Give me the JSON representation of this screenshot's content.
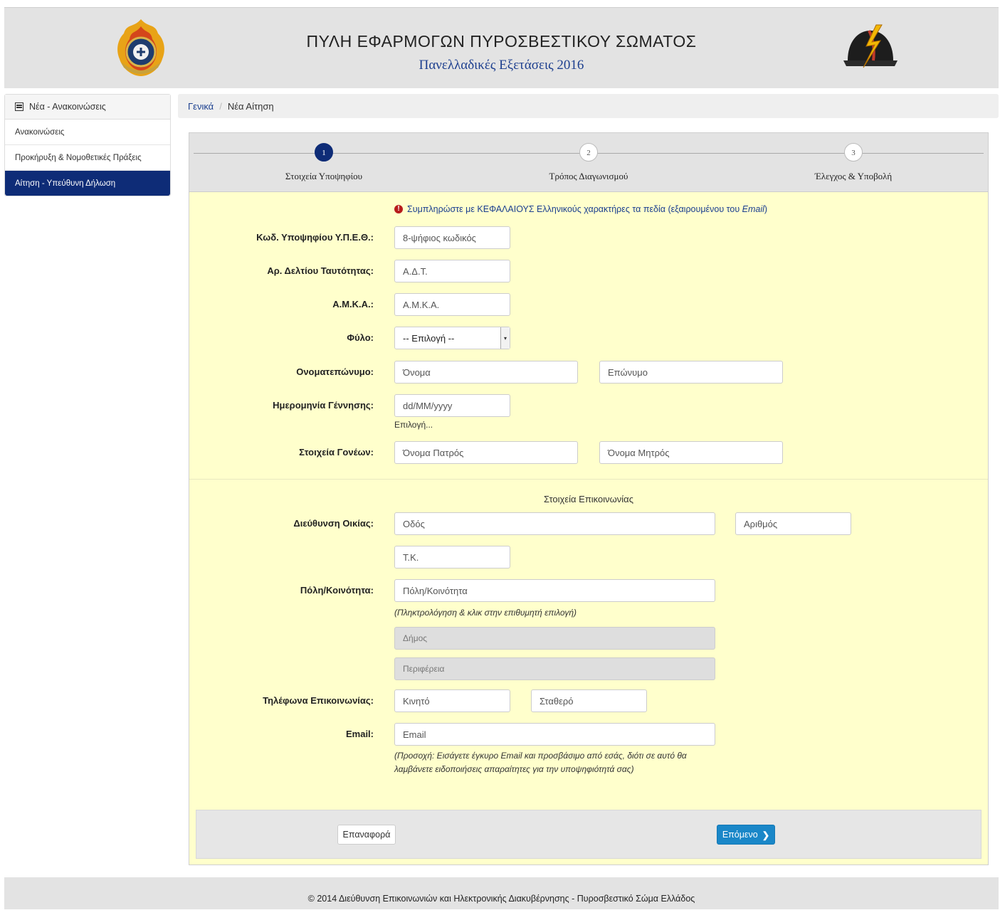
{
  "header": {
    "title": "ΠΥΛΗ ΕΦΑΡΜΟΓΩΝ ΠΥΡΟΣΒΕΣΤΙΚΟΥ ΣΩΜΑΤΟΣ",
    "subtitle": "Πανελλαδικές Εξετάσεις 2016"
  },
  "sidebar": {
    "heading": "Νέα - Ανακοινώσεις",
    "items": [
      {
        "label": "Ανακοινώσεις"
      },
      {
        "label": "Προκήρυξη & Νομοθετικές Πράξεις"
      },
      {
        "label": "Αίτηση - Υπεύθυνη Δήλωση"
      }
    ]
  },
  "breadcrumb": {
    "root": "Γενικά",
    "separator": "/",
    "current": "Νέα Αίτηση"
  },
  "wizard": {
    "steps": [
      {
        "number": "1",
        "label": "Στοιχεία Υποψηφίου"
      },
      {
        "number": "2",
        "label": "Τρόπος Διαγωνισμού"
      },
      {
        "number": "3",
        "label": "Έλεγχος & Υποβολή"
      }
    ],
    "active_step": 1
  },
  "form": {
    "notice_prefix": "Συμπληρώστε με ΚΕΦΑΛΑΙΟΥΣ Ελληνικούς χαρακτήρες τα πεδία (εξαιρουμένου του ",
    "notice_email": "Email",
    "notice_suffix": ")",
    "candidate_code": {
      "label": "Κωδ. Υποψηφίου Υ.Π.Ε.Θ.:",
      "placeholder": "8-ψήφιος κωδικός"
    },
    "id_card": {
      "label": "Αρ. Δελτίου Ταυτότητας:",
      "placeholder": "Α.Δ.Τ."
    },
    "amka": {
      "label": "Α.Μ.Κ.Α.:",
      "placeholder": "Α.Μ.Κ.Α."
    },
    "gender": {
      "label": "Φύλο:",
      "selected": "-- Επιλογή --"
    },
    "full_name": {
      "label": "Ονοματεπώνυμο:",
      "first_placeholder": "Όνομα",
      "last_placeholder": "Επώνυμο"
    },
    "birth_date": {
      "label": "Ημερομηνία Γέννησης:",
      "placeholder": "dd/MM/yyyy",
      "picker_link": "Επιλογή..."
    },
    "parents": {
      "label": "Στοιχεία Γονέων:",
      "father_placeholder": "Όνομα Πατρός",
      "mother_placeholder": "Όνομα Μητρός"
    },
    "contact_section_title": "Στοιχεία Επικοινωνίας",
    "address": {
      "label": "Διεύθυνση Οικίας:",
      "street_placeholder": "Οδός",
      "number_placeholder": "Αριθμός",
      "zip_placeholder": "Τ.Κ."
    },
    "city": {
      "label": "Πόλη/Κοινότητα:",
      "placeholder": "Πόλη/Κοινότητα",
      "help": "(Πληκτρολόγηση & κλικ στην επιθυμητή επιλογή)",
      "municipality": "Δήμος",
      "region": "Περιφέρεια"
    },
    "phones": {
      "label": "Τηλέφωνα Επικοινωνίας:",
      "mobile_placeholder": "Κινητό",
      "landline_placeholder": "Σταθερό"
    },
    "email": {
      "label": "Email:",
      "placeholder": "Email",
      "help_line1": "(Προσοχή: Εισάγετε έγκυρο Email και προσβάσιμο από εσάς, διότι σε αυτό θα",
      "help_line2": "λαμβάνετε ειδοποιήσεις απαραίτητες για την υποψηφιότητά σας)"
    }
  },
  "actions": {
    "reset_label": "Επαναφορά",
    "next_label": "Επόμενο"
  },
  "footer": {
    "text": "© 2014 Διεύθυνση Επικοινωνιών και Ηλεκτρονικής Διακυβέρνησης - Πυροσβεστικό Σώμα Ελλάδος"
  },
  "colors": {
    "primary_navy": "#0e2c77",
    "form_background": "#ffffcc",
    "next_button": "#1a87c8",
    "notice_icon": "#b71c1c"
  }
}
